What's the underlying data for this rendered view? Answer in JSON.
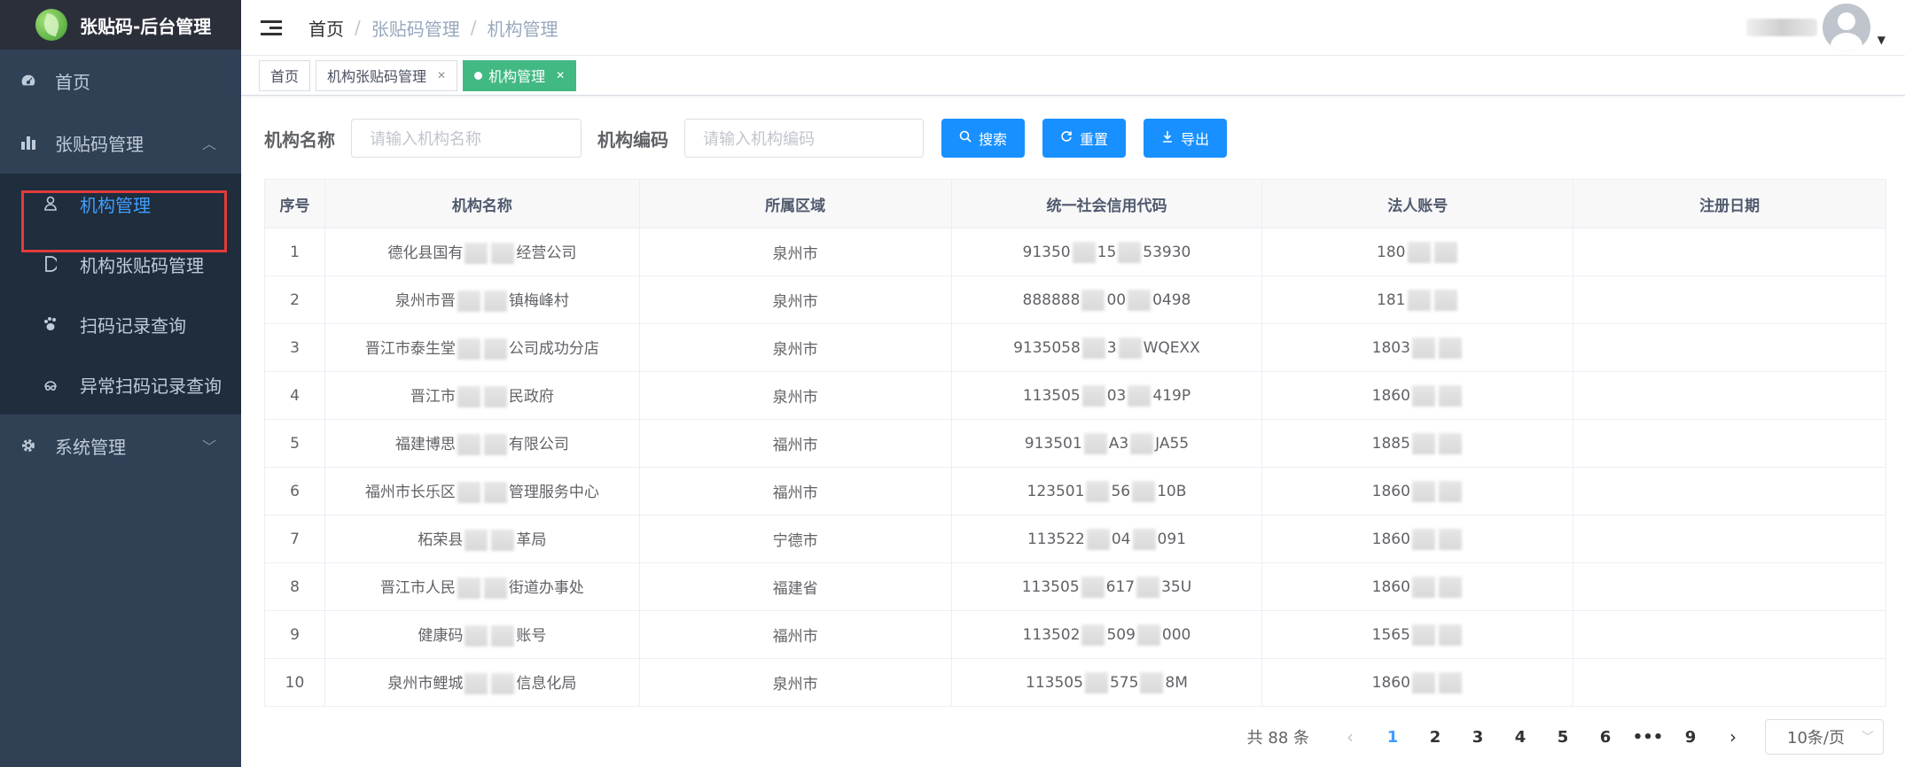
{
  "app": {
    "title": "张贴码-后台管理"
  },
  "sidebar": {
    "items": [
      {
        "label": "首页",
        "icon": "dashboard-icon"
      },
      {
        "label": "张贴码管理",
        "icon": "chart-icon",
        "expanded": true,
        "children": [
          {
            "label": "机构管理",
            "icon": "user-icon",
            "active": true
          },
          {
            "label": "机构张贴码管理",
            "icon": "doc-icon"
          },
          {
            "label": "扫码记录查询",
            "icon": "paw-icon"
          },
          {
            "label": "异常扫码记录查询",
            "icon": "druid-icon"
          }
        ]
      },
      {
        "label": "系统管理",
        "icon": "gear-icon"
      }
    ]
  },
  "header": {
    "breadcrumb": [
      "首页",
      "张贴码管理",
      "机构管理"
    ]
  },
  "tags": [
    {
      "label": "首页"
    },
    {
      "label": "机构张贴码管理"
    },
    {
      "label": "机构管理",
      "active": true
    }
  ],
  "search": {
    "name_label": "机构名称",
    "name_placeholder": "请输入机构名称",
    "code_label": "机构编码",
    "code_placeholder": "请输入机构编码",
    "search_btn": "搜索",
    "reset_btn": "重置",
    "export_btn": "导出"
  },
  "table": {
    "headers": [
      "序号",
      "机构名称",
      "所属区域",
      "统一社会信用代码",
      "法人账号",
      "注册日期"
    ],
    "rows": [
      {
        "no": "1",
        "name_a": "德化县国有",
        "name_b": "经营公司",
        "region": "泉州市",
        "code_a": "91350",
        "code_b": "15",
        "code_c": "53930",
        "acct": "180",
        "date": ""
      },
      {
        "no": "2",
        "name_a": "泉州市晋",
        "name_b": "镇梅峰村",
        "region": "泉州市",
        "code_a": "888888",
        "code_b": "00",
        "code_c": "0498",
        "acct": "181",
        "date": ""
      },
      {
        "no": "3",
        "name_a": "晋江市泰生堂",
        "name_b": "公司成功分店",
        "region": "泉州市",
        "code_a": "9135058",
        "code_b": "3",
        "code_c": "WQEXX",
        "acct": "1803",
        "date": ""
      },
      {
        "no": "4",
        "name_a": "晋江市",
        "name_b": "民政府",
        "region": "泉州市",
        "code_a": "113505",
        "code_b": "03",
        "code_c": "419P",
        "acct": "1860",
        "date": ""
      },
      {
        "no": "5",
        "name_a": "福建博思",
        "name_b": "有限公司",
        "region": "福州市",
        "code_a": "913501",
        "code_b": "A3",
        "code_c": "JA55",
        "acct": "1885",
        "date": ""
      },
      {
        "no": "6",
        "name_a": "福州市长乐区",
        "name_b": "管理服务中心",
        "region": "福州市",
        "code_a": "123501",
        "code_b": "56",
        "code_c": "10B",
        "acct": "1860",
        "date": ""
      },
      {
        "no": "7",
        "name_a": "柘荣县",
        "name_b": "革局",
        "region": "宁德市",
        "code_a": "113522",
        "code_b": "04",
        "code_c": "091",
        "acct": "1860",
        "date": ""
      },
      {
        "no": "8",
        "name_a": "晋江市人民",
        "name_b": "街道办事处",
        "region": "福建省",
        "code_a": "113505",
        "code_b": "617",
        "code_c": "35U",
        "acct": "1860",
        "date": ""
      },
      {
        "no": "9",
        "name_a": "健康码",
        "name_b": "账号",
        "region": "福州市",
        "code_a": "113502",
        "code_b": "509",
        "code_c": "000",
        "acct": "1565",
        "date": ""
      },
      {
        "no": "10",
        "name_a": "泉州市鲤城",
        "name_b": "信息化局",
        "region": "泉州市",
        "code_a": "113505",
        "code_b": "575",
        "code_c": "8M",
        "acct": "1860",
        "date": ""
      }
    ]
  },
  "pagination": {
    "total": "共 88 条",
    "pages": [
      "1",
      "2",
      "3",
      "4",
      "5",
      "6",
      "•••",
      "9"
    ],
    "current": "1",
    "page_size": "10条/页"
  },
  "colors": {
    "sidebar_bg": "#304156",
    "accent": "#1890ff",
    "active_tag": "#42b983",
    "active_link": "#409eff",
    "highlight_box": "#e23b3b"
  }
}
